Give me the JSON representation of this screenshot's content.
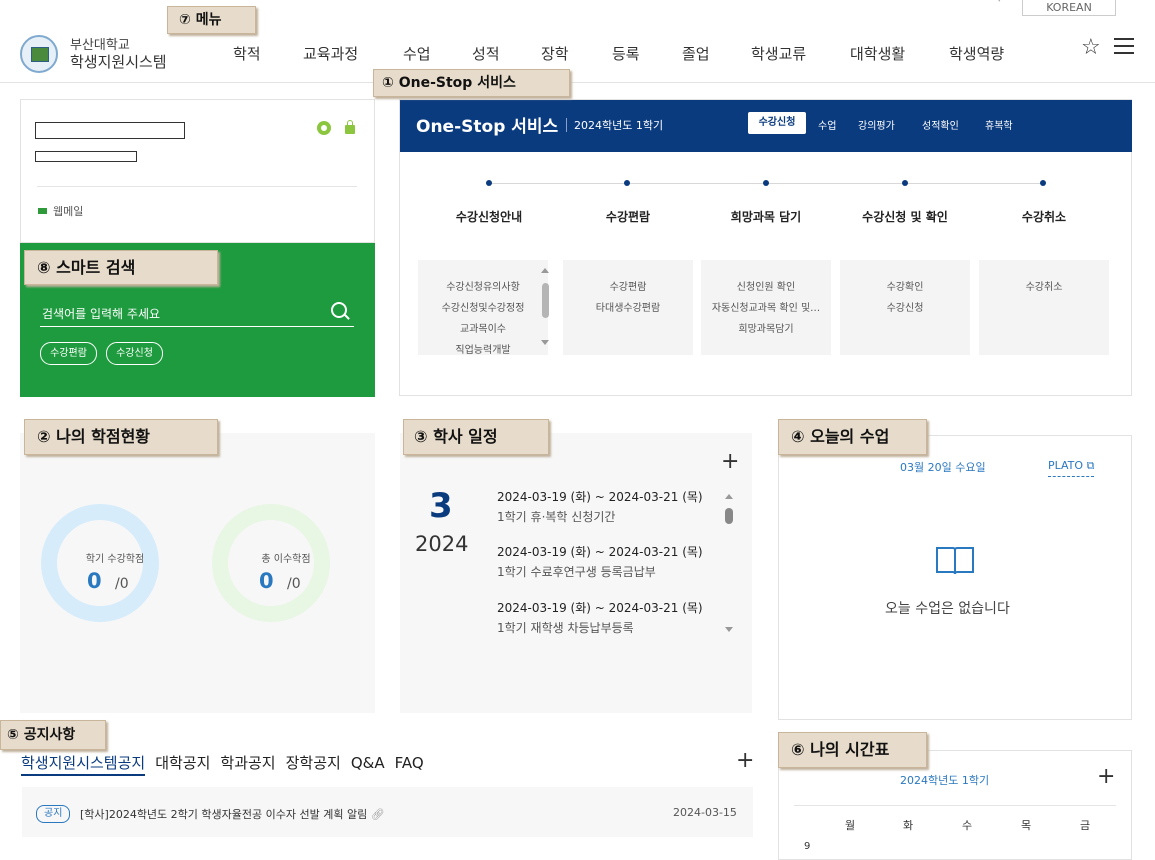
{
  "header": {
    "logo_line1": "부산대학교",
    "logo_line2": "학생지원시스템",
    "language": "KOREAN",
    "nav": [
      "학적",
      "교육과정",
      "수업",
      "성적",
      "장학",
      "등록",
      "졸업",
      "학생교류",
      "대학생활",
      "학생역량"
    ],
    "icons": [
      "star-icon",
      "hamburger-icon"
    ]
  },
  "tags": {
    "menu": "⑦ 메뉴",
    "onestop": "① One-Stop 서비스",
    "smart_search": "⑧ 스마트 검색",
    "credits": "② 나의 학점현황",
    "schedule": "③ 학사 일정",
    "today": "④ 오늘의 수업",
    "notice": "⑤ 공지사항",
    "timetable": "⑥ 나의 시간표"
  },
  "profile": {
    "webmail_label": "웹메일",
    "icons": [
      "gear-icon",
      "lock-icon",
      "mail-icon"
    ]
  },
  "search": {
    "placeholder": "검색어를 입력해 주세요",
    "quick_links": [
      "수강편람",
      "수강신청"
    ]
  },
  "onestop": {
    "title": "One-Stop 서비스",
    "term": "2024학년도 1학기",
    "tabs": [
      "수강신청",
      "수업",
      "강의평가",
      "성적확인",
      "휴복학"
    ],
    "active_tab": "수강신청",
    "steps": [
      {
        "title": "수강신청안내",
        "links": [
          "수강신청유의사항",
          "수강신청및수강정정",
          "교과목이수",
          "직업능력개발"
        ]
      },
      {
        "title": "수강편람",
        "links": [
          "수강편람",
          "타대생수강편람"
        ]
      },
      {
        "title": "희망과목 담기",
        "links": [
          "신청인원 확인",
          "자동신청교과목 확인 및…",
          "희망과목담기"
        ]
      },
      {
        "title": "수강신청 및 확인",
        "links": [
          "수강확인",
          "수강신청"
        ]
      },
      {
        "title": "수강취소",
        "links": [
          "수강취소"
        ]
      }
    ]
  },
  "credits": {
    "items": [
      {
        "label": "학기 수강학점",
        "value": "0",
        "total": "/0"
      },
      {
        "label": "총 이수학점",
        "value": "0",
        "total": "/0"
      }
    ],
    "colors": {
      "ring1": "#d6ecfb",
      "ring2": "#e8f6e4"
    }
  },
  "schedule": {
    "month": "3",
    "year": "2024",
    "items": [
      {
        "date": "2024-03-19 (화) ~ 2024-03-21 (목)",
        "desc": "1학기 휴·복학 신청기간"
      },
      {
        "date": "2024-03-19 (화) ~ 2024-03-21 (목)",
        "desc": "1학기 수료후연구생 등록금납부"
      },
      {
        "date": "2024-03-19 (화) ~ 2024-03-21 (목)",
        "desc": "1학기 재학생 차등납부등록"
      }
    ],
    "plus": "+"
  },
  "today": {
    "date": "03월 20일 수요일",
    "plato": "PLATO",
    "empty_message": "오늘 수업은 없습니다",
    "icons": [
      "book-icon"
    ]
  },
  "notices": {
    "tabs": [
      "학생지원시스템공지",
      "대학공지",
      "학과공지",
      "장학공지",
      "Q&A",
      "FAQ"
    ],
    "active_tab": "학생지원시스템공지",
    "plus": "+",
    "items": [
      {
        "badge": "공지",
        "title": "[학사]2024학년도 2학기 학생자율전공 이수자 선발 계획 알림",
        "date": "2024-03-15"
      }
    ]
  },
  "timetable": {
    "term": "2024학년도 1학기",
    "plus": "+",
    "days": [
      "월",
      "화",
      "수",
      "목",
      "금"
    ],
    "first_hour": "9"
  },
  "theme": {
    "navy": "#0b3b7f",
    "green": "#1d9b3e",
    "blue": "#2a78c0",
    "tag_bg": "#e7dccb"
  }
}
